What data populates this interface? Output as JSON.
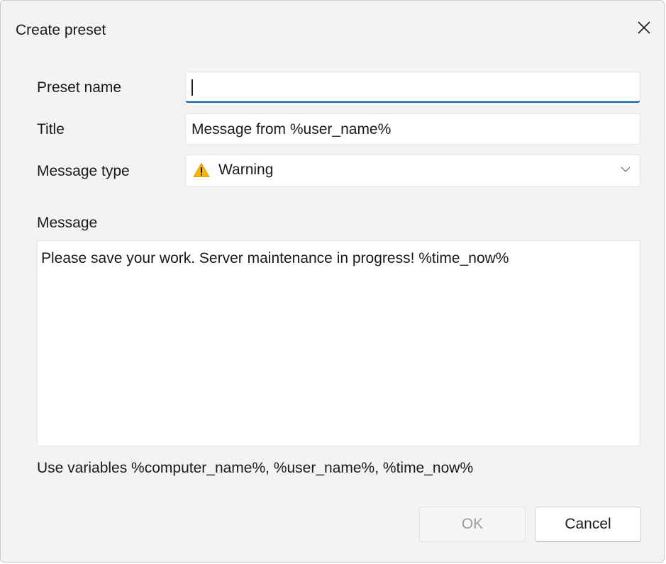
{
  "window": {
    "title": "Create preset",
    "close_glyph": "✕"
  },
  "form": {
    "preset_name": {
      "label": "Preset name",
      "value": ""
    },
    "title": {
      "label": "Title",
      "value": "Message from %user_name%"
    },
    "message_type": {
      "label": "Message type",
      "value": "Warning",
      "icon": "warning-icon"
    },
    "message": {
      "label": "Message",
      "value": "Please save your work. Server maintenance in progress! %time_now%"
    },
    "hint": "Use variables %computer_name%, %user_name%, %time_now%"
  },
  "buttons": {
    "ok": {
      "label": "OK",
      "enabled": false
    },
    "cancel": {
      "label": "Cancel",
      "enabled": true
    }
  },
  "colors": {
    "accent": "#005fb8",
    "warning": "#f7b500"
  }
}
